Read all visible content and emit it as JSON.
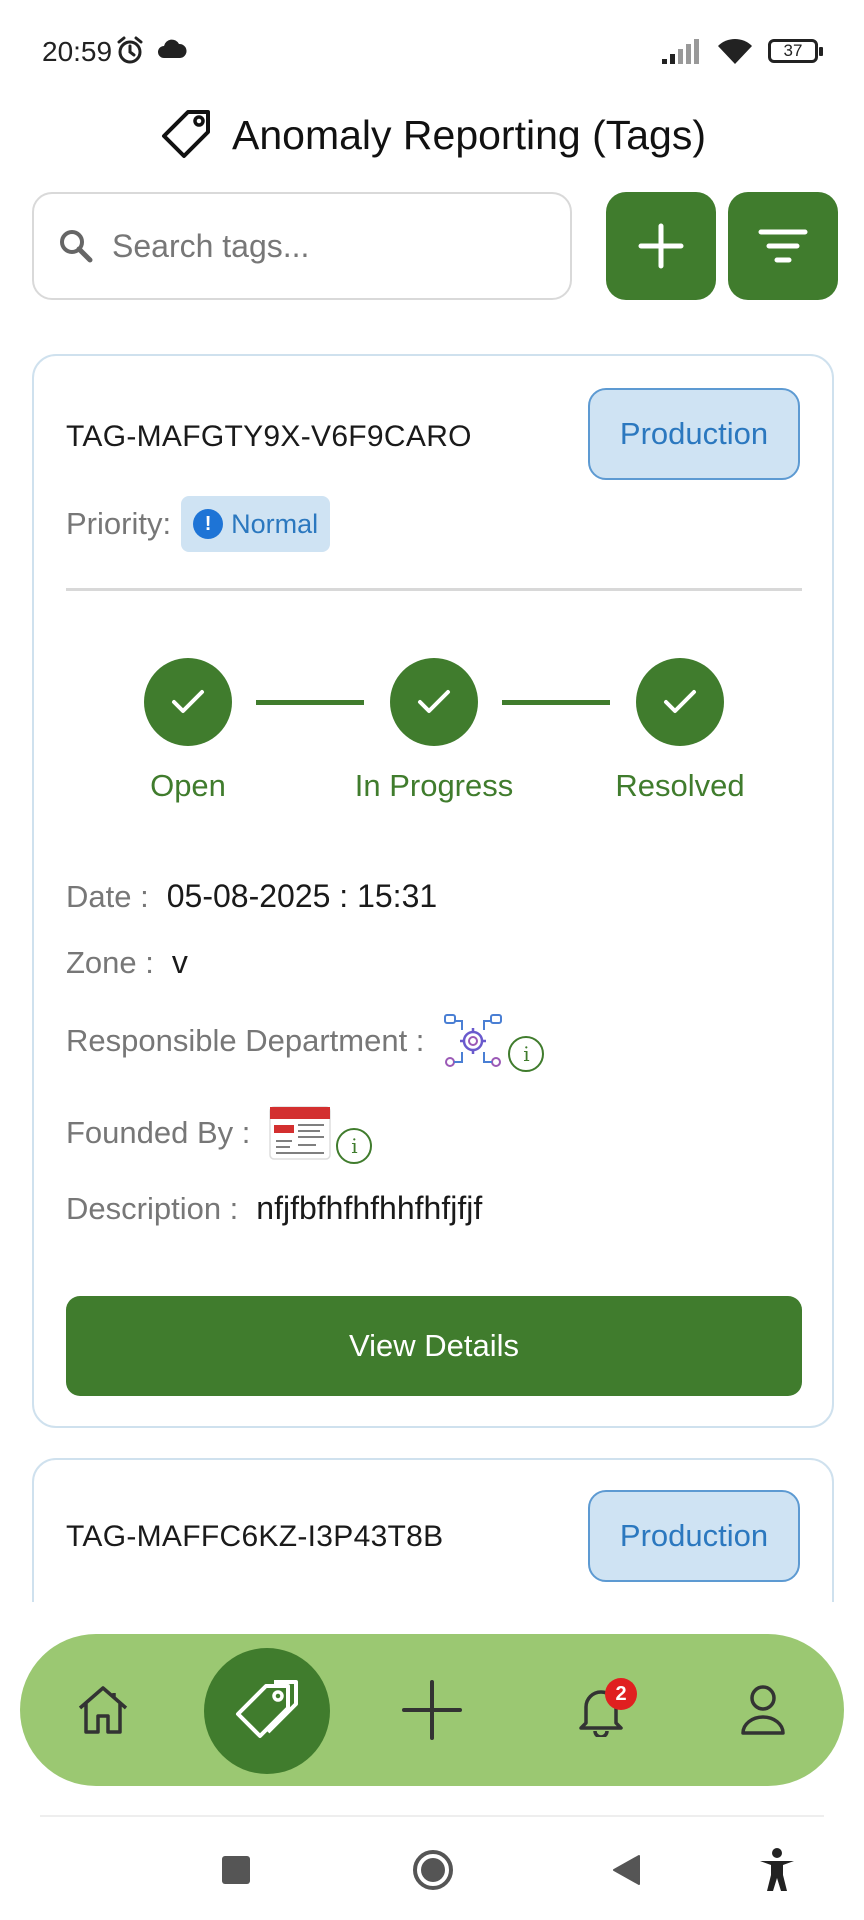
{
  "status_bar": {
    "time": "20:59",
    "battery": "37",
    "icons": [
      "alarm-icon",
      "cloud-icon",
      "signal-icon",
      "wifi-icon",
      "battery-icon"
    ]
  },
  "header": {
    "title": "Anomaly Reporting (Tags)",
    "icon": "tag-icon"
  },
  "search": {
    "placeholder": "Search tags...",
    "value": ""
  },
  "actions": {
    "add_icon": "plus-icon",
    "filter_icon": "filter-icon"
  },
  "colors": {
    "primary": "#407c2d",
    "nav_bg": "#9bc872",
    "badge_blue": "#2b78bf",
    "badge_bg": "#cfe3f3",
    "notification": "#e02020"
  },
  "cards": [
    {
      "tag_id": "TAG-MAFGTY9X-V6F9CARO",
      "department_badge": "Production",
      "priority_label": "Priority:",
      "priority_value": "Normal",
      "steps": [
        {
          "label": "Open",
          "done": true
        },
        {
          "label": "In Progress",
          "done": true
        },
        {
          "label": "Resolved",
          "done": true
        }
      ],
      "date_label": "Date :",
      "date_value": "05-08-2025 : 15:31",
      "zone_label": "Zone :",
      "zone_value": "v",
      "responsible_label": "Responsible Department :",
      "founded_label": "Founded By :",
      "description_label": "Description :",
      "description_value": "nfjfbfhfhfhhfhfjfjf",
      "button_label": "View Details"
    },
    {
      "tag_id": "TAG-MAFFC6KZ-I3P43T8B",
      "department_badge": "Production"
    }
  ],
  "bottom_nav": {
    "items": [
      "home-icon",
      "tag-icon",
      "plus-icon",
      "bell-icon",
      "user-icon"
    ],
    "active": "tag-icon",
    "notification_count": "2"
  },
  "system_nav": [
    "recents-square-icon",
    "home-circle-icon",
    "back-triangle-icon",
    "accessibility-icon"
  ]
}
